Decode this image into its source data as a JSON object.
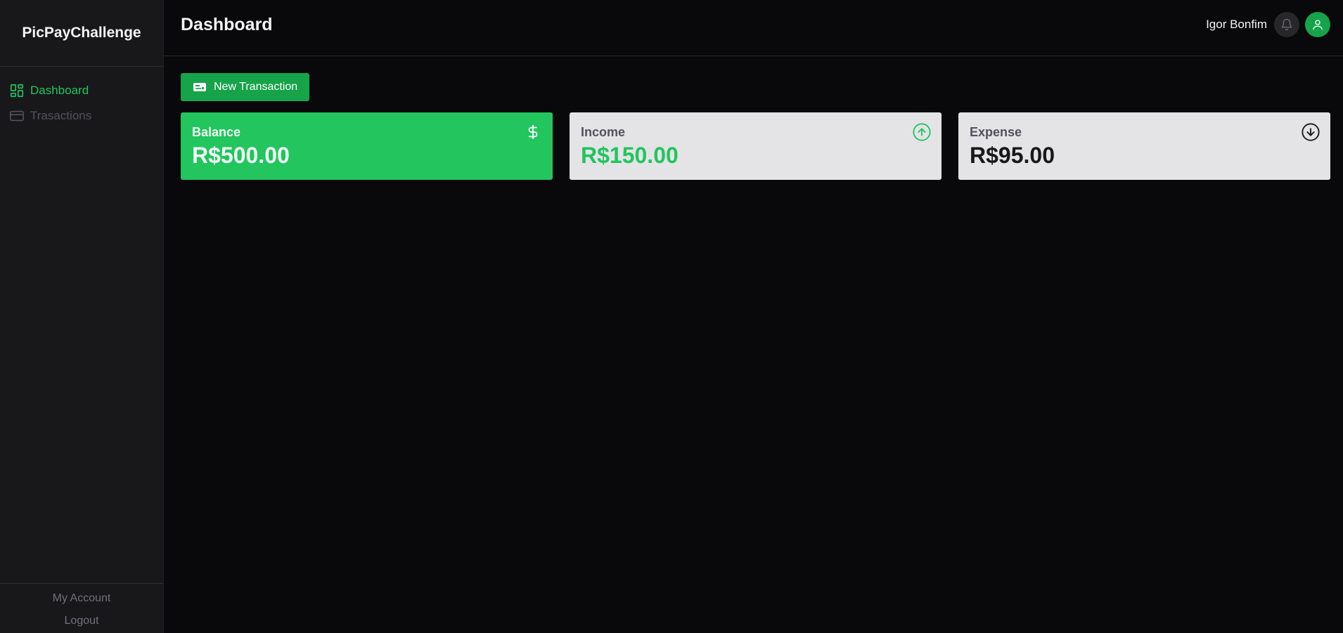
{
  "sidebar": {
    "brand": "PicPayChallenge",
    "items": [
      {
        "label": "Dashboard",
        "icon": "dashboard-grid-icon",
        "active": true
      },
      {
        "label": "Trasactions",
        "icon": "credit-card-icon",
        "active": false
      }
    ],
    "footer": {
      "account_label": "My Account",
      "logout_label": "Logout"
    }
  },
  "header": {
    "title": "Dashboard",
    "user_name": "Igor Bonfim",
    "bell_icon": "bell-icon",
    "avatar_icon": "user-icon"
  },
  "toolbar": {
    "new_transaction_label": "New Transaction",
    "icon": "id-card-icon"
  },
  "cards": {
    "balance": {
      "label": "Balance",
      "value": "R$500.00",
      "icon": "dollar-icon"
    },
    "income": {
      "label": "Income",
      "value": "R$150.00",
      "icon": "arrow-up-circle-icon"
    },
    "expense": {
      "label": "Expense",
      "value": "R$95.00",
      "icon": "arrow-down-circle-icon"
    }
  },
  "colors": {
    "accent": "#22c55e",
    "accent_dark": "#16a34a",
    "background": "#09090b",
    "sidebar": "#18181b",
    "card_light": "#e4e4e7"
  }
}
